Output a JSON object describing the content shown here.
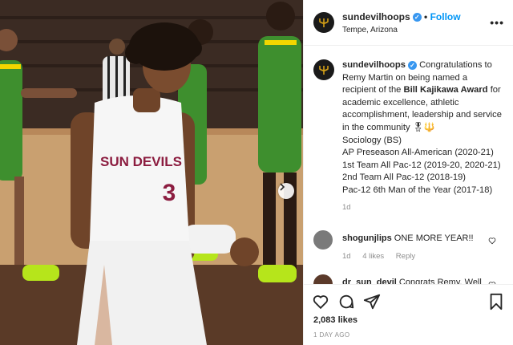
{
  "post": {
    "username": "sundevilhoops",
    "follow_label": "Follow",
    "location": "Tempe, Arizona",
    "more_icon": "more-icon",
    "jersey_text": "SUN DEVILS",
    "jersey_number": "3"
  },
  "caption": {
    "username": "sundevilhoops",
    "text_before": "Congratulations to Remy Martin on being named a recipient of the ",
    "award": "Bill Kajikawa Award",
    "text_after": " for academic excellence, athletic accomplishment, leadership and service in the community 🎖🔱",
    "lines": [
      "Sociology (BS)",
      "AP Preseason All-American (2020-21)",
      "1st Team All Pac-12 (2019-20, 2020-21)",
      "2nd Team All Pac-12 (2018-19)",
      "Pac-12 6th Man of the Year (2017-18)"
    ],
    "time": "1d"
  },
  "comments": [
    {
      "username": "shogunjlips",
      "text": "ONE MORE YEAR!!",
      "time": "1d",
      "likes": "4 likes",
      "reply": "Reply"
    },
    {
      "username": "dr_sun_devil",
      "text": "Congrats Remy. Well"
    }
  ],
  "footer": {
    "likes": "2,083 likes",
    "posted": "1 DAY AGO"
  },
  "colors": {
    "accent": "#0095f6",
    "verified": "#3897f0",
    "muted": "#8e8e8e",
    "asu_maroon": "#8c1d40",
    "oregon_green": "#3e8f2e",
    "oregon_yellow": "#f2d600"
  }
}
